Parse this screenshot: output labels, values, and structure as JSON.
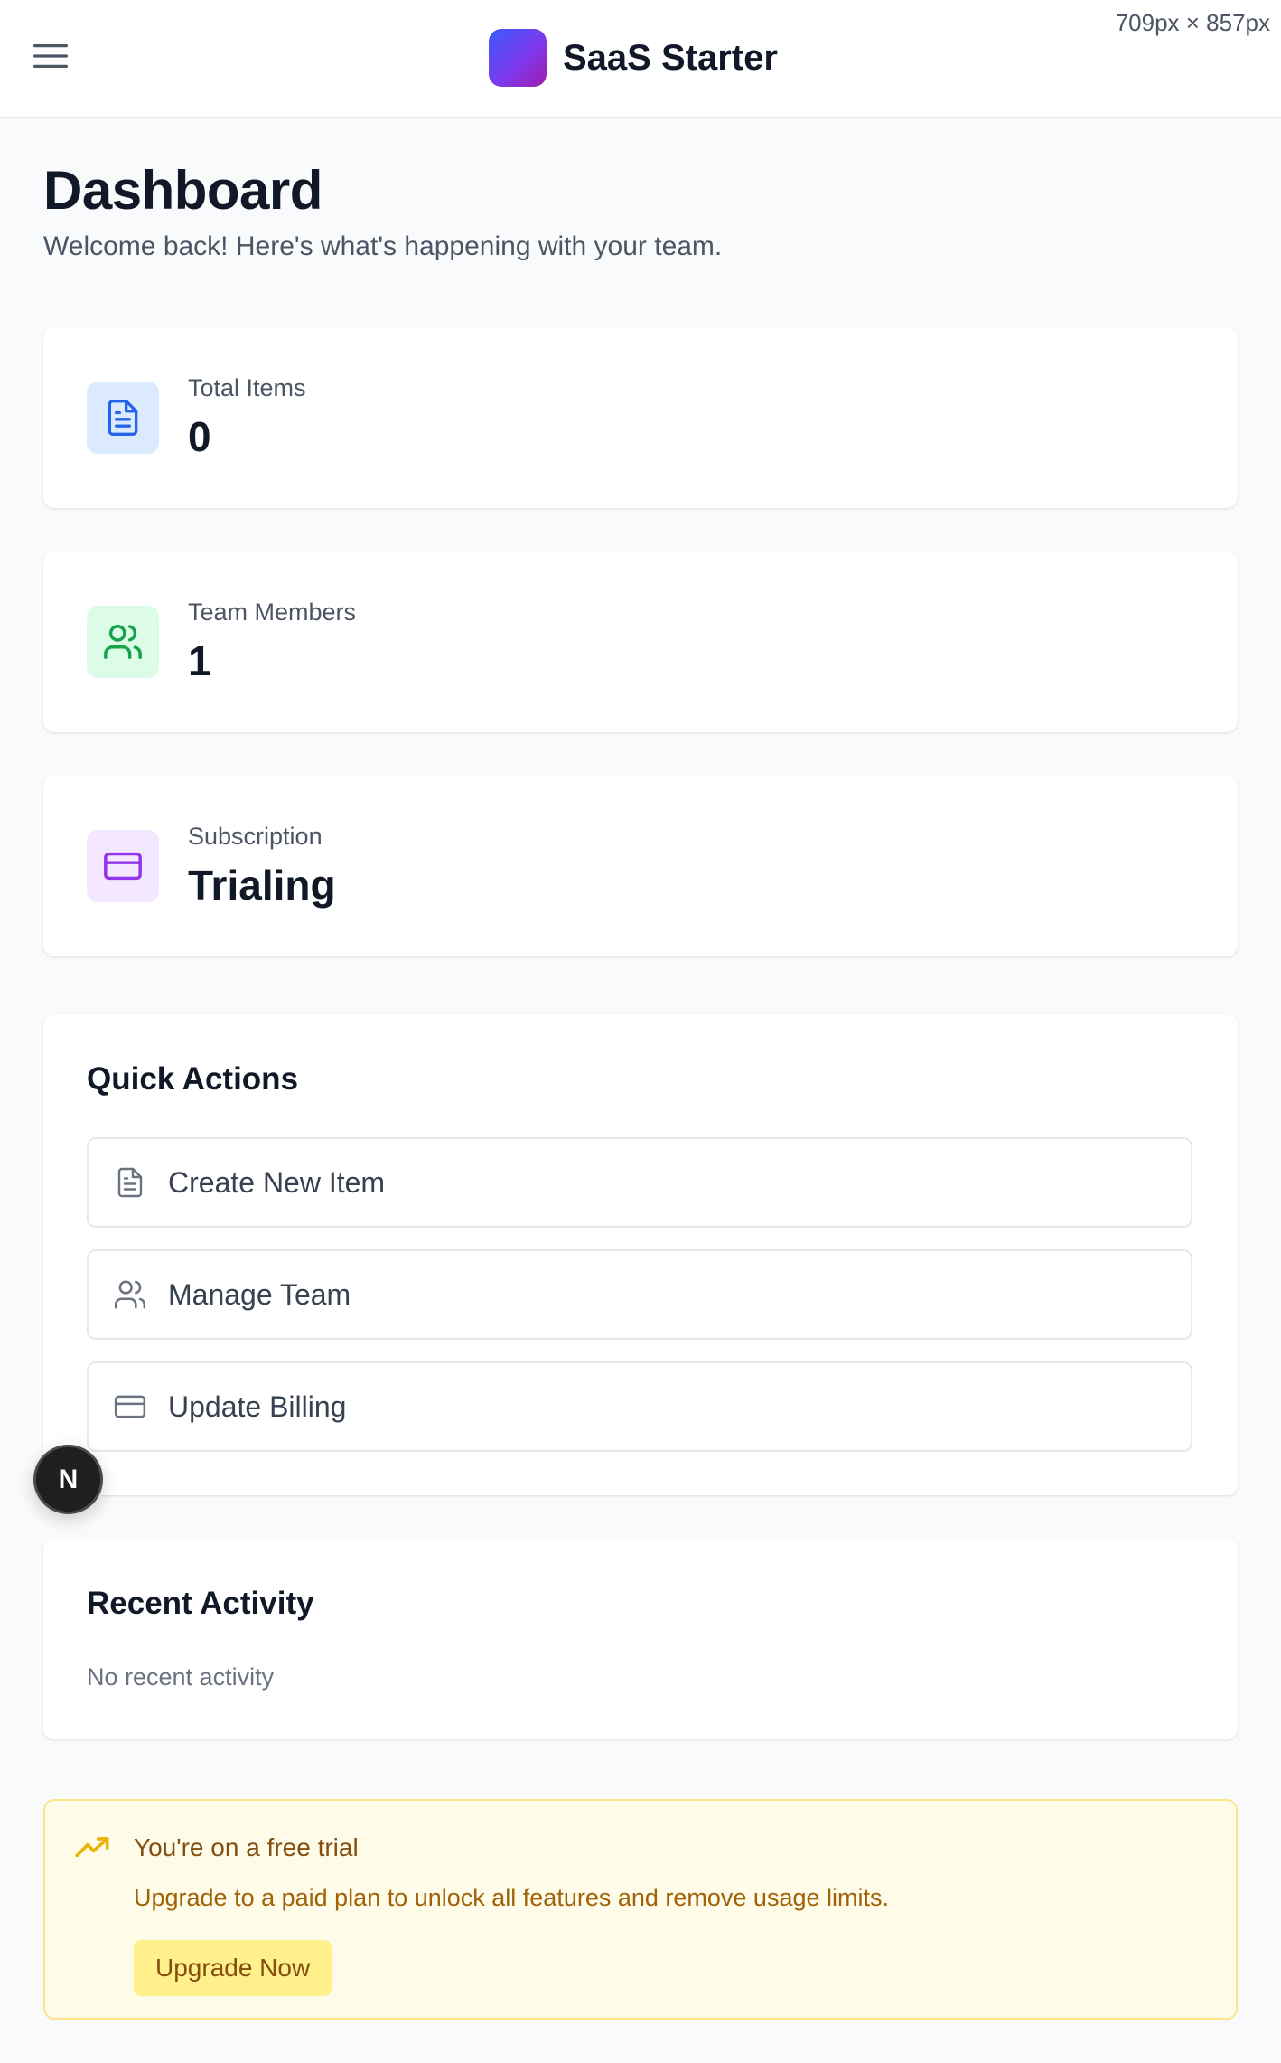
{
  "header": {
    "app_name": "SaaS Starter",
    "viewport_label": "709px × 857px",
    "menu_icon": "hamburger-menu-icon"
  },
  "page": {
    "title": "Dashboard",
    "subtitle": "Welcome back! Here's what's happening with your team."
  },
  "stats": [
    {
      "label": "Total Items",
      "value": "0",
      "icon": "document-icon",
      "color": "#2563eb",
      "bg": "#dbeafe"
    },
    {
      "label": "Team Members",
      "value": "1",
      "icon": "users-icon",
      "color": "#16a34a",
      "bg": "#dcfce7"
    },
    {
      "label": "Subscription",
      "value": "Trialing",
      "icon": "credit-card-icon",
      "color": "#9333ea",
      "bg": "#f3e8ff"
    }
  ],
  "quick_actions": {
    "title": "Quick Actions",
    "items": [
      {
        "label": "Create New Item",
        "icon": "document-icon"
      },
      {
        "label": "Manage Team",
        "icon": "users-icon"
      },
      {
        "label": "Update Billing",
        "icon": "credit-card-icon"
      }
    ]
  },
  "recent_activity": {
    "title": "Recent Activity",
    "empty_text": "No recent activity"
  },
  "trial_banner": {
    "title": "You're on a free trial",
    "text": "Upgrade to a paid plan to unlock all features and remove usage limits.",
    "button_label": "Upgrade Now",
    "icon": "trending-up-icon"
  },
  "dev_badge": {
    "label": "N"
  },
  "colors": {
    "accent_gradient_start": "#3b5bfd",
    "accent_gradient_end": "#a21caf",
    "trial_bg": "#fefce8",
    "trial_border": "#fde68a"
  }
}
